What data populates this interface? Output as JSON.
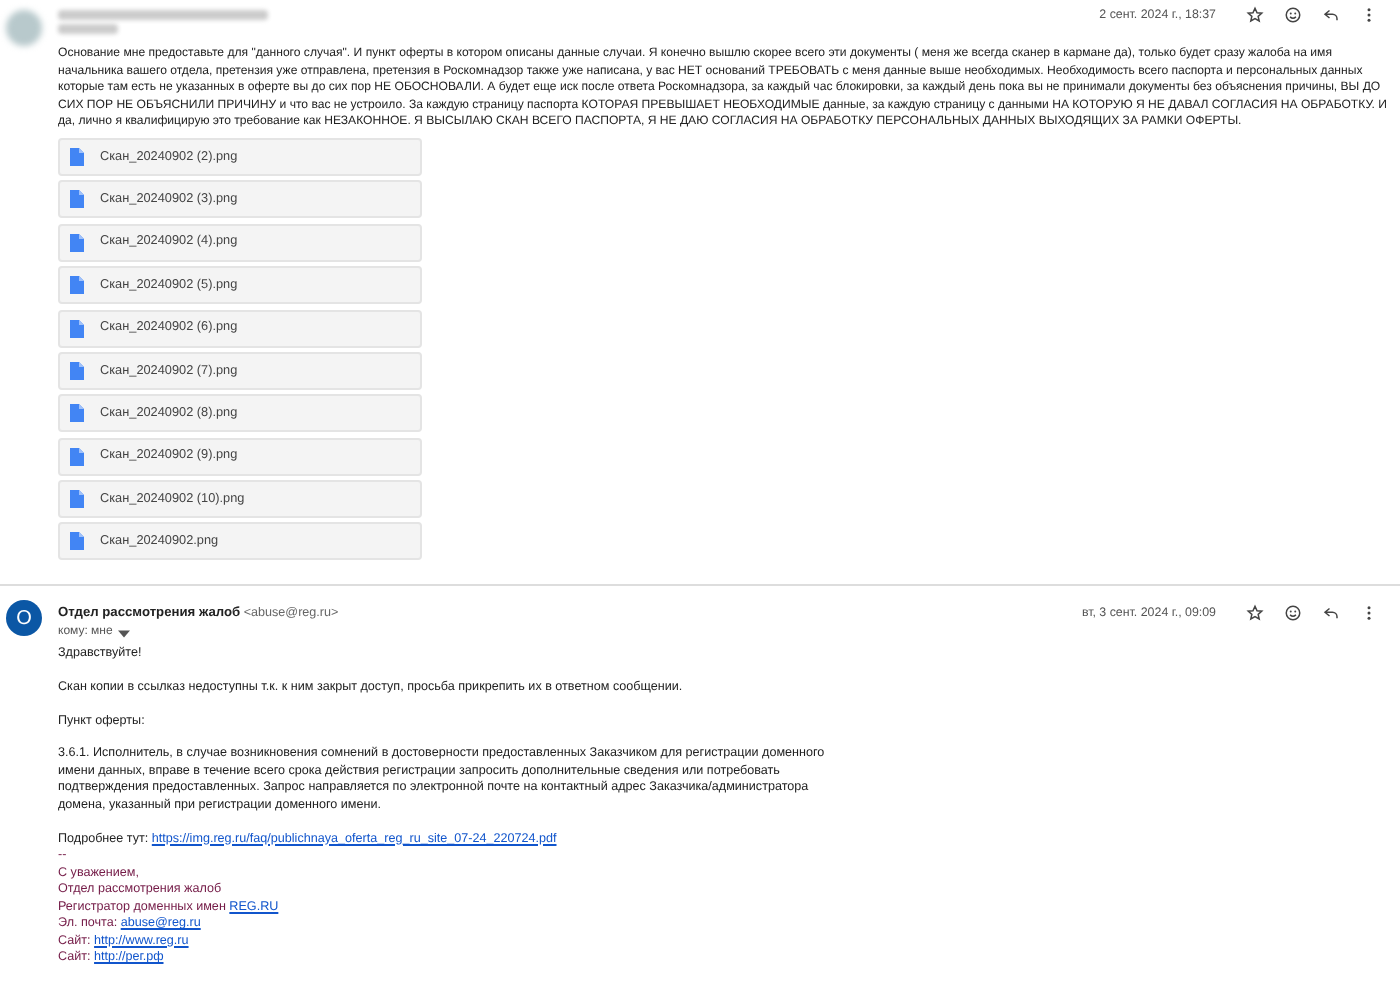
{
  "messages": [
    {
      "sender_redacted": true,
      "date": "2 сент. 2024 г., 18:37",
      "body": [
        "Основание мне предоставьте для \"данного случая\". И пункт оферты в котором описаны данные случаи. Я конечно вышлю скорее всего эти документы ( меня же всегда сканер в кармане да), только будет сразу жалоба на имя начальника вашего отдела, претензия уже отправлена, претензия в Роскомнадзор также уже написана, у вас НЕТ оснований ТРЕБОВАТЬ с меня данные выше необходимых. Необходимость всего паспорта и персональных данных которые там есть не указанных в оферте вы до сих пор НЕ ОБОСНОВАЛИ. А будет еще иск после ответа Роскомнадзора, за каждый час блокировки, за каждый день пока вы не принимали документы без объяснения причины, ВЫ ДО СИХ ПОР НЕ ОБЪЯСНИЛИ ПРИЧИНУ и что вас не устроило. За каждую страницу паспорта КОТОРАЯ ПРЕВЫШАЕТ НЕОБХОДИМЫЕ данные, за каждую страницу с данными НА КОТОРУЮ Я НЕ ДАВАЛ СОГЛАСИЯ НА ОБРАБОТКУ. И да, лично я квалифицирую это требование как НЕЗАКОННОЕ. Я ВЫСЫЛАЮ СКАН ВСЕГО ПАСПОРТА, Я НЕ ДАЮ СОГЛАСИЯ НА ОБРАБОТКУ ПЕРСОНАЛЬНЫХ ДАННЫХ ВЫХОДЯЩИХ ЗА РАМКИ ОФЕРТЫ."
      ],
      "attachments": [
        "Скан_20240902 (2).png",
        "Скан_20240902 (3).png",
        "Скан_20240902 (4).png",
        "Скан_20240902 (5).png",
        "Скан_20240902 (6).png",
        "Скан_20240902 (7).png",
        "Скан_20240902 (8).png",
        "Скан_20240902 (9).png",
        "Скан_20240902 (10).png",
        "Скан_20240902.png"
      ]
    },
    {
      "sender_redacted": false,
      "avatar": "О",
      "sender": "Отдел рассмотрения жалоб",
      "email": "<abuse@reg.ru>",
      "to": "кому: мне",
      "date": "вт, 3 сент. 2024 г., 09:09",
      "body": [
        "Здравствуйте!",
        "Скан копии в ссылказ недоступны т.к. к ним закрыт доступ, просьба прикрепить их в ответном сообщении.",
        "Пункт оферты:",
        " 3.6.1. Исполнитель, в случае возникновения сомнений в достоверности предоставленных Заказчиком для регистрации доменного имени данных, вправе в течение всего срока действия регистрации запросить дополнительные сведения или потребовать подтверждения предоставленных. Запрос направляется по электронной почте на контактный адрес Заказчика/администратора домена, указанный при регистрации доменного имени."
      ],
      "more": {
        "text": "Подробнее тут: ",
        "link": "https://img.reg.ru/faq/publichnaya_oferta_reg_ru_site_07-24_220724.pdf"
      },
      "signature": [
        {
          "text": "--"
        },
        {
          "text": "С уважением,"
        },
        {
          "text": "Отдел рассмотрения жалоб"
        },
        {
          "text": "Регистратор доменных имен ",
          "link": "REG.RU"
        },
        {
          "text": "Эл. почта: ",
          "link": "abuse@reg.ru"
        },
        {
          "text": "Сайт: ",
          "link": "http://www.reg.ru"
        },
        {
          "text": "Сайт: ",
          "link": "http://рег.рф"
        }
      ]
    }
  ]
}
